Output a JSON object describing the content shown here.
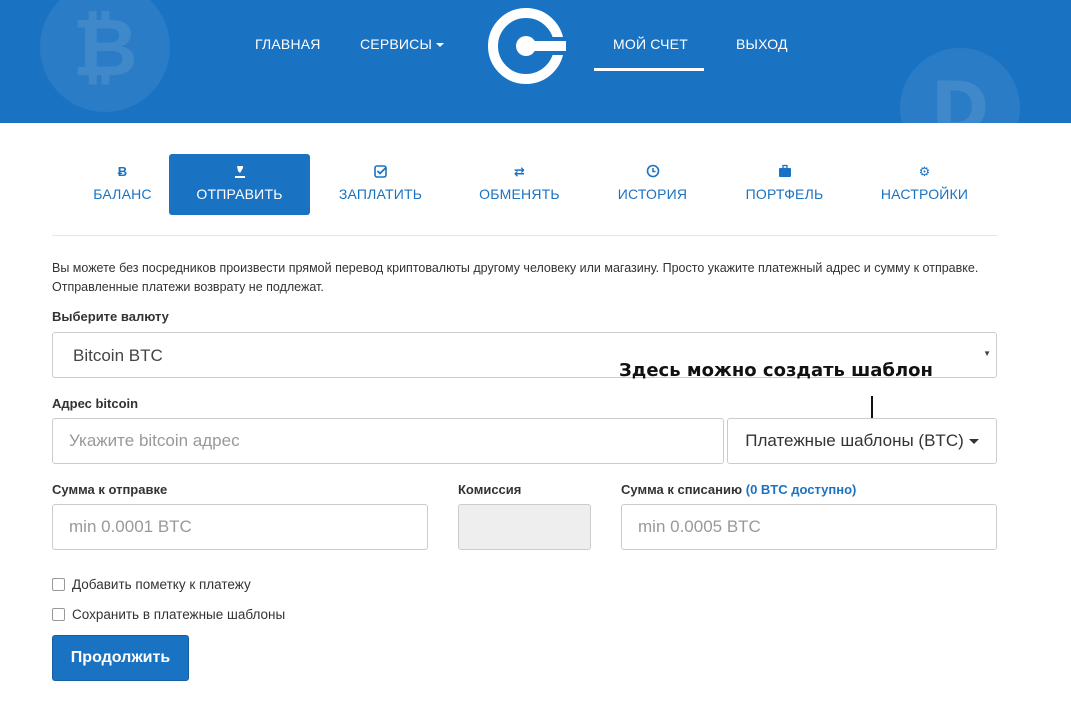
{
  "nav": {
    "main": "ГЛАВНАЯ",
    "services": "СЕРВИСЫ",
    "account": "МОЙ СЧЕТ",
    "logout": "ВЫХОД"
  },
  "tabs": [
    {
      "label": "БАЛАНС",
      "icon": "bitcoin-icon"
    },
    {
      "label": "ОТПРАВИТЬ",
      "icon": "send-icon"
    },
    {
      "label": "ЗАПЛАТИТЬ",
      "icon": "checkbox-icon"
    },
    {
      "label": "ОБМЕНЯТЬ",
      "icon": "exchange-icon"
    },
    {
      "label": "ИСТОРИЯ",
      "icon": "clock-icon"
    },
    {
      "label": "ПОРТФЕЛЬ",
      "icon": "briefcase-icon"
    },
    {
      "label": "НАСТРОЙКИ",
      "icon": "gear-icon"
    }
  ],
  "active_tab": "ОТПРАВИТЬ",
  "form": {
    "intro": "Вы можете без посредников произвести прямой перевод криптовалюты другому человеку или магазину. Просто укажите платежный адрес и сумму к отправке. Отправленные платежи возврату не подлежат.",
    "currency_label": "Выберите валюту",
    "currency_value": "Bitcoin BTC",
    "address_label": "Адрес bitcoin",
    "address_placeholder": "Укажите bitcoin адрес",
    "templates_button": "Платежные шаблоны (BTC)",
    "amount_label": "Сумма к отправке",
    "amount_placeholder": "min 0.0001 BTC",
    "fee_label": "Комиссия",
    "debit_label": "Сумма к списанию",
    "debit_available": "(0 BTC доступно)",
    "debit_placeholder": "min 0.0005 BTC",
    "add_note": "Добавить пометку к платежу",
    "save_template": "Сохранить в платежные шаблоны",
    "submit": "Продолжить"
  },
  "annotation": "Здесь можно создать шаблон",
  "colors": {
    "brand": "#1a73c2",
    "header_bg": "#1a73c2"
  }
}
